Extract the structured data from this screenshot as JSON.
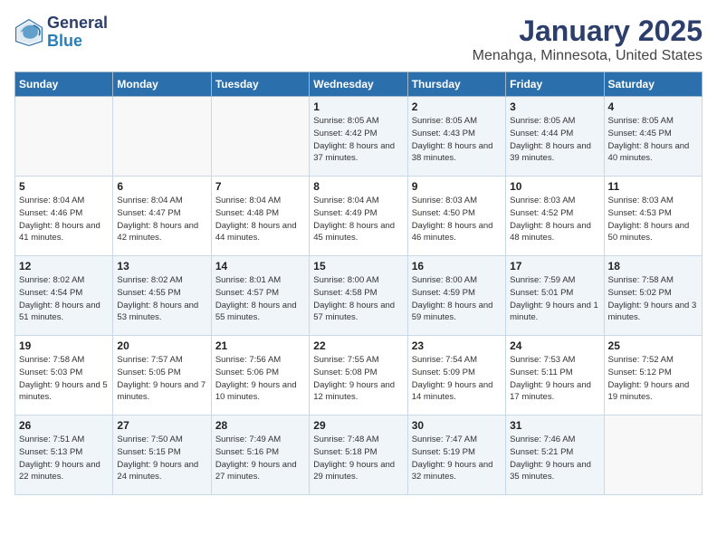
{
  "header": {
    "logo_general": "General",
    "logo_blue": "Blue",
    "title": "January 2025",
    "subtitle": "Menahga, Minnesota, United States"
  },
  "days_of_week": [
    "Sunday",
    "Monday",
    "Tuesday",
    "Wednesday",
    "Thursday",
    "Friday",
    "Saturday"
  ],
  "weeks": [
    [
      {
        "day": "",
        "info": ""
      },
      {
        "day": "",
        "info": ""
      },
      {
        "day": "",
        "info": ""
      },
      {
        "day": "1",
        "info": "Sunrise: 8:05 AM\nSunset: 4:42 PM\nDaylight: 8 hours and 37 minutes."
      },
      {
        "day": "2",
        "info": "Sunrise: 8:05 AM\nSunset: 4:43 PM\nDaylight: 8 hours and 38 minutes."
      },
      {
        "day": "3",
        "info": "Sunrise: 8:05 AM\nSunset: 4:44 PM\nDaylight: 8 hours and 39 minutes."
      },
      {
        "day": "4",
        "info": "Sunrise: 8:05 AM\nSunset: 4:45 PM\nDaylight: 8 hours and 40 minutes."
      }
    ],
    [
      {
        "day": "5",
        "info": "Sunrise: 8:04 AM\nSunset: 4:46 PM\nDaylight: 8 hours and 41 minutes."
      },
      {
        "day": "6",
        "info": "Sunrise: 8:04 AM\nSunset: 4:47 PM\nDaylight: 8 hours and 42 minutes."
      },
      {
        "day": "7",
        "info": "Sunrise: 8:04 AM\nSunset: 4:48 PM\nDaylight: 8 hours and 44 minutes."
      },
      {
        "day": "8",
        "info": "Sunrise: 8:04 AM\nSunset: 4:49 PM\nDaylight: 8 hours and 45 minutes."
      },
      {
        "day": "9",
        "info": "Sunrise: 8:03 AM\nSunset: 4:50 PM\nDaylight: 8 hours and 46 minutes."
      },
      {
        "day": "10",
        "info": "Sunrise: 8:03 AM\nSunset: 4:52 PM\nDaylight: 8 hours and 48 minutes."
      },
      {
        "day": "11",
        "info": "Sunrise: 8:03 AM\nSunset: 4:53 PM\nDaylight: 8 hours and 50 minutes."
      }
    ],
    [
      {
        "day": "12",
        "info": "Sunrise: 8:02 AM\nSunset: 4:54 PM\nDaylight: 8 hours and 51 minutes."
      },
      {
        "day": "13",
        "info": "Sunrise: 8:02 AM\nSunset: 4:55 PM\nDaylight: 8 hours and 53 minutes."
      },
      {
        "day": "14",
        "info": "Sunrise: 8:01 AM\nSunset: 4:57 PM\nDaylight: 8 hours and 55 minutes."
      },
      {
        "day": "15",
        "info": "Sunrise: 8:00 AM\nSunset: 4:58 PM\nDaylight: 8 hours and 57 minutes."
      },
      {
        "day": "16",
        "info": "Sunrise: 8:00 AM\nSunset: 4:59 PM\nDaylight: 8 hours and 59 minutes."
      },
      {
        "day": "17",
        "info": "Sunrise: 7:59 AM\nSunset: 5:01 PM\nDaylight: 9 hours and 1 minute."
      },
      {
        "day": "18",
        "info": "Sunrise: 7:58 AM\nSunset: 5:02 PM\nDaylight: 9 hours and 3 minutes."
      }
    ],
    [
      {
        "day": "19",
        "info": "Sunrise: 7:58 AM\nSunset: 5:03 PM\nDaylight: 9 hours and 5 minutes."
      },
      {
        "day": "20",
        "info": "Sunrise: 7:57 AM\nSunset: 5:05 PM\nDaylight: 9 hours and 7 minutes."
      },
      {
        "day": "21",
        "info": "Sunrise: 7:56 AM\nSunset: 5:06 PM\nDaylight: 9 hours and 10 minutes."
      },
      {
        "day": "22",
        "info": "Sunrise: 7:55 AM\nSunset: 5:08 PM\nDaylight: 9 hours and 12 minutes."
      },
      {
        "day": "23",
        "info": "Sunrise: 7:54 AM\nSunset: 5:09 PM\nDaylight: 9 hours and 14 minutes."
      },
      {
        "day": "24",
        "info": "Sunrise: 7:53 AM\nSunset: 5:11 PM\nDaylight: 9 hours and 17 minutes."
      },
      {
        "day": "25",
        "info": "Sunrise: 7:52 AM\nSunset: 5:12 PM\nDaylight: 9 hours and 19 minutes."
      }
    ],
    [
      {
        "day": "26",
        "info": "Sunrise: 7:51 AM\nSunset: 5:13 PM\nDaylight: 9 hours and 22 minutes."
      },
      {
        "day": "27",
        "info": "Sunrise: 7:50 AM\nSunset: 5:15 PM\nDaylight: 9 hours and 24 minutes."
      },
      {
        "day": "28",
        "info": "Sunrise: 7:49 AM\nSunset: 5:16 PM\nDaylight: 9 hours and 27 minutes."
      },
      {
        "day": "29",
        "info": "Sunrise: 7:48 AM\nSunset: 5:18 PM\nDaylight: 9 hours and 29 minutes."
      },
      {
        "day": "30",
        "info": "Sunrise: 7:47 AM\nSunset: 5:19 PM\nDaylight: 9 hours and 32 minutes."
      },
      {
        "day": "31",
        "info": "Sunrise: 7:46 AM\nSunset: 5:21 PM\nDaylight: 9 hours and 35 minutes."
      },
      {
        "day": "",
        "info": ""
      }
    ]
  ]
}
